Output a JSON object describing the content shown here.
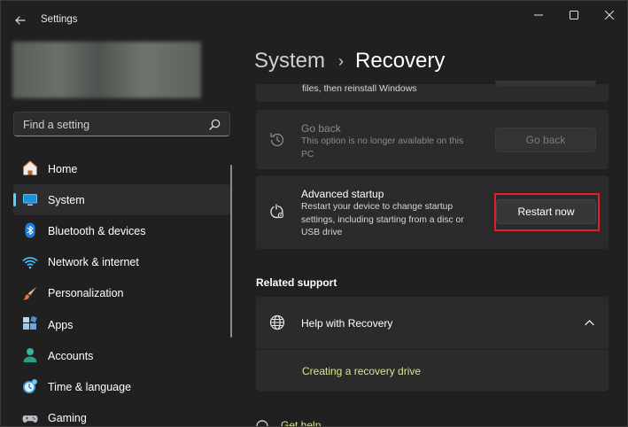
{
  "window": {
    "title": "Settings"
  },
  "search": {
    "placeholder": "Find a setting"
  },
  "nav": {
    "items": [
      {
        "label": "Home",
        "icon": "home-icon"
      },
      {
        "label": "System",
        "icon": "system-icon",
        "active": true
      },
      {
        "label": "Bluetooth & devices",
        "icon": "bluetooth-icon"
      },
      {
        "label": "Network & internet",
        "icon": "wifi-icon"
      },
      {
        "label": "Personalization",
        "icon": "brush-icon"
      },
      {
        "label": "Apps",
        "icon": "apps-icon"
      },
      {
        "label": "Accounts",
        "icon": "person-icon"
      },
      {
        "label": "Time & language",
        "icon": "clock-globe-icon"
      },
      {
        "label": "Gaming",
        "icon": "gamepad-icon"
      }
    ]
  },
  "breadcrumb": {
    "parent": "System",
    "current": "Recovery"
  },
  "reset_card": {
    "text_line": "files, then reinstall Windows"
  },
  "go_back_card": {
    "title": "Go back",
    "desc_line1": "This option is no longer available on this",
    "desc_line2": "PC",
    "button": "Go back"
  },
  "advanced_card": {
    "title": "Advanced startup",
    "desc_line1": "Restart your device to change startup",
    "desc_line2": "settings, including starting from a disc or",
    "desc_line3": "USB drive",
    "button": "Restart now"
  },
  "related": {
    "heading": "Related support",
    "help_title": "Help with Recovery",
    "link": "Creating a recovery drive"
  },
  "footer": {
    "get_help": "Get help"
  },
  "colors": {
    "accent": "#60cdff",
    "link": "#dbe58e",
    "highlight": "#e0202e"
  }
}
